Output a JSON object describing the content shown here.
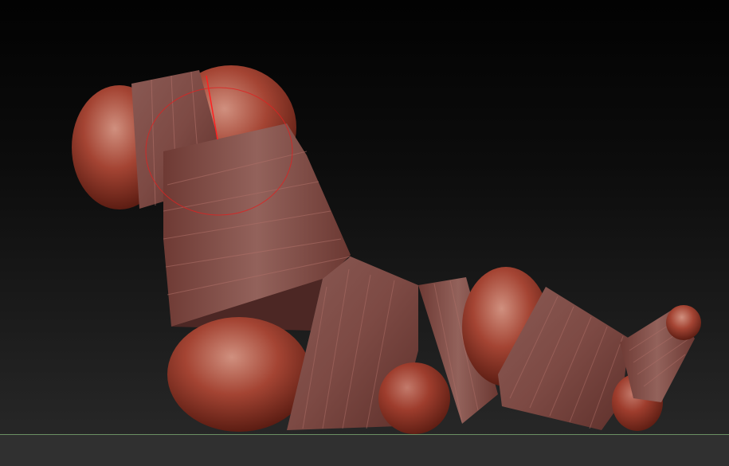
{
  "app": {
    "name": ""
  },
  "viewport": {
    "background_top": "#020202",
    "background_bottom": "#2a2a2a",
    "floor_line_color": "#6b8f63",
    "floor_color": "#303030"
  },
  "model": {
    "material_color": "#9a3a2c",
    "highlight_color": "#c9877a",
    "shadow_color": "#4a1a14",
    "band_color": "#7a4c47",
    "band_dark_color": "#4e2b28",
    "edge_line_color": "#b07068"
  },
  "brush_cursor": {
    "color": "#e02020"
  }
}
